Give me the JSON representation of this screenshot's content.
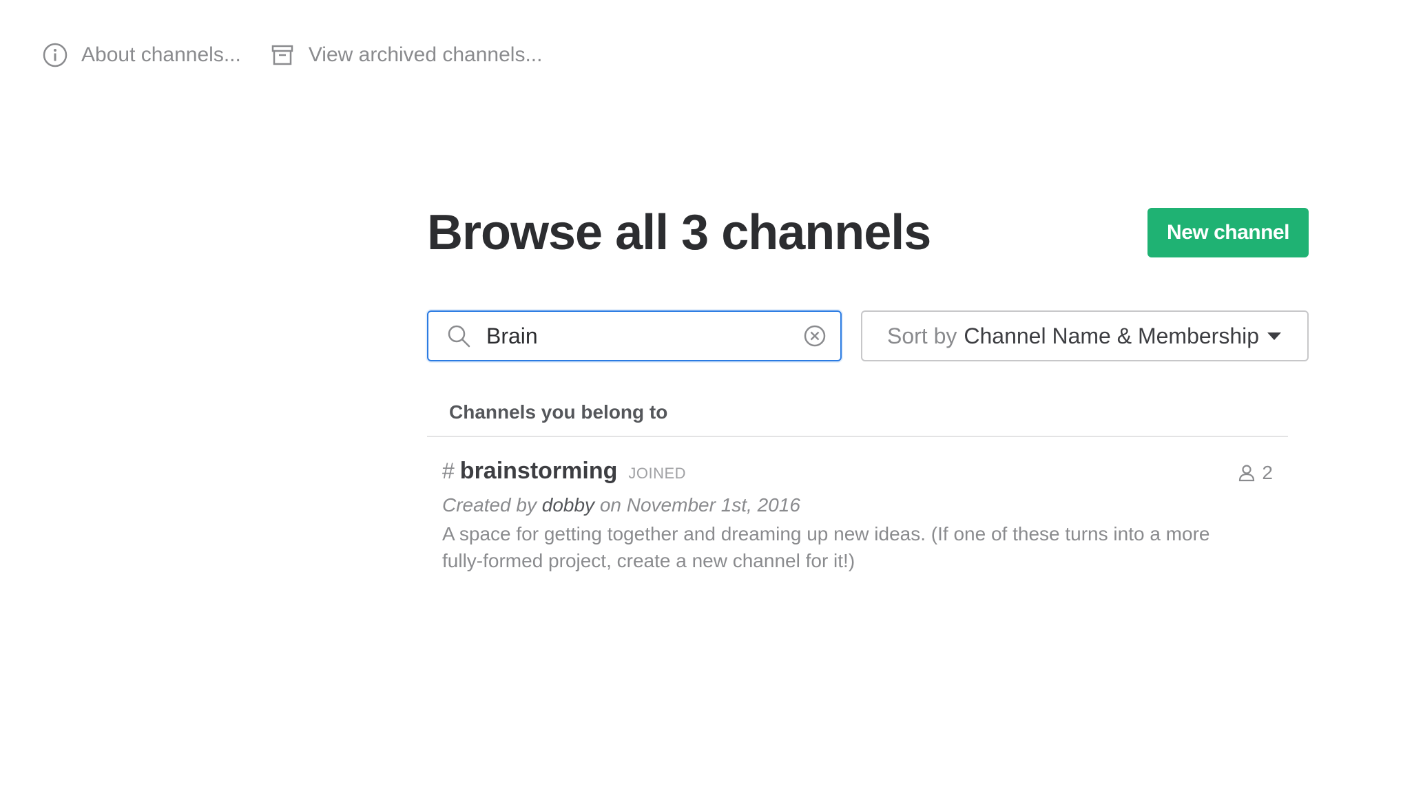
{
  "top_links": {
    "about": "About channels...",
    "archived": "View archived channels..."
  },
  "header": {
    "title": "Browse all 3 channels",
    "new_channel_label": "New channel"
  },
  "search": {
    "value": "Brain",
    "placeholder": ""
  },
  "sort": {
    "prefix": "Sort by",
    "value": "Channel Name & Membership"
  },
  "section": {
    "title": "Channels you belong to"
  },
  "channels": [
    {
      "hash": "#",
      "name": "brainstorming",
      "badge": "JOINED",
      "member_count": "2",
      "created_prefix": "Created by",
      "creator": "dobby",
      "created_suffix": "on November 1st, 2016",
      "description": "A space for getting together and dreaming up new ideas. (If one of these turns into a more fully-formed project, create a new channel for it!)"
    }
  ],
  "colors": {
    "accent": "#1fb273",
    "focus": "#2b7be2",
    "muted": "#8a8b8e"
  },
  "icons": {
    "about": "info-icon",
    "archived": "archive-box-icon",
    "search": "search-icon",
    "clear": "clear-circle-x-icon",
    "sort": "caret-down-icon",
    "members": "person-icon"
  }
}
